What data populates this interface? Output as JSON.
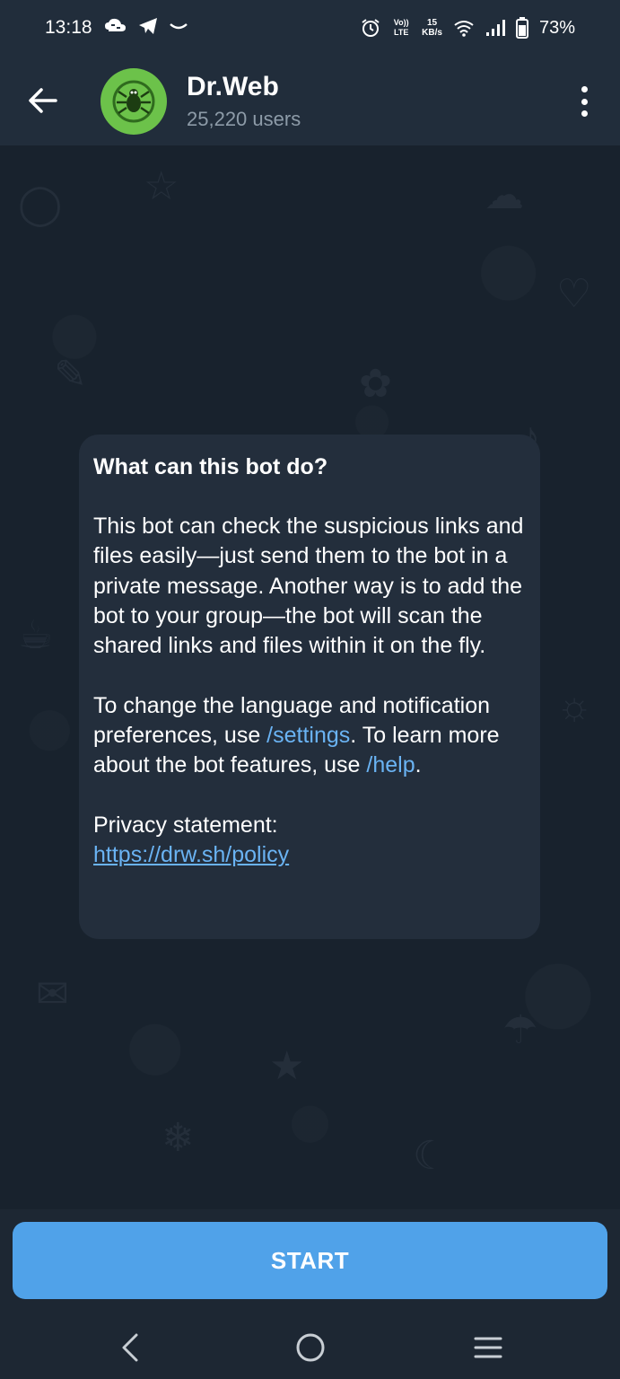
{
  "status_bar": {
    "time": "13:18",
    "left_icons": [
      "cloud-sync-icon",
      "telegram-icon",
      "smile-icon"
    ],
    "right_icons": [
      "alarm-icon",
      "volte-icon",
      "wifi-icon",
      "signal-icon",
      "battery-icon"
    ],
    "volte_label": "Vo)) LTE",
    "net_speed_value": "15",
    "net_speed_unit": "KB/s",
    "battery_percent": "73%"
  },
  "header": {
    "title": "Dr.Web",
    "subtitle": "25,220 users",
    "avatar_color": "#6cc24a",
    "back_icon": "arrow-left-icon",
    "menu_icon": "more-vertical-icon"
  },
  "info_card": {
    "title": "What can this bot do?",
    "paragraph1": "This bot can check the suspicious links and files easily—just send them to the bot in a private message. Another way is to add the bot to your group—the bot will scan the shared links and files within it on the fly.",
    "paragraph2_prefix": "To change the language and notification preferences, use ",
    "settings_command": "/settings",
    "paragraph2_mid": ". To learn more about the bot features, use ",
    "help_command": "/help",
    "paragraph2_suffix": ".",
    "privacy_label": "Privacy statement:",
    "privacy_url": "https://drw.sh/policy",
    "link_color": "#6ab3f3"
  },
  "start_button": {
    "label": "START",
    "color": "#50a2e9"
  },
  "nav_bar": {
    "back_icon": "chevron-left-icon",
    "home_icon": "circle-home-icon",
    "recents_icon": "menu-lines-icon"
  }
}
